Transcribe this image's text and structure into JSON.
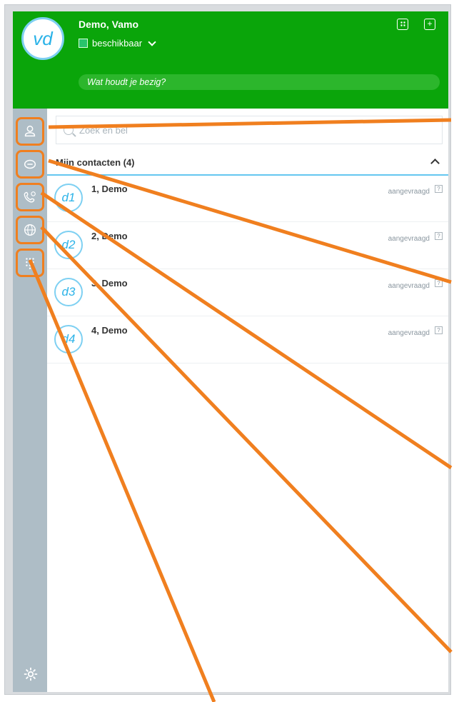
{
  "user": {
    "initials": "vd",
    "name": "Demo, Vamo",
    "presence": "beschikbaar"
  },
  "status_placeholder": "Wat houdt je bezig?",
  "search": {
    "placeholder": "Zoek en bel"
  },
  "contacts_section": {
    "title": "Mijn contacten (4)"
  },
  "contacts": [
    {
      "avatar": "d1",
      "name": "1, Demo",
      "status": "aangevraagd"
    },
    {
      "avatar": "d2",
      "name": "2, Demo",
      "status": "aangevraagd"
    },
    {
      "avatar": "d3",
      "name": "3, Demo",
      "status": "aangevraagd"
    },
    {
      "avatar": "d4",
      "name": "4, Demo",
      "status": "aangevraagd"
    }
  ],
  "sidebar_icons": [
    "contacts-icon",
    "chat-icon",
    "calls-icon",
    "globe-icon",
    "dialpad-icon",
    "gear-icon"
  ],
  "colors": {
    "header": "#0aa50a",
    "sidebar": "#aebdc6",
    "accent": "#64c6f0",
    "annotation": "#f07f1f"
  }
}
